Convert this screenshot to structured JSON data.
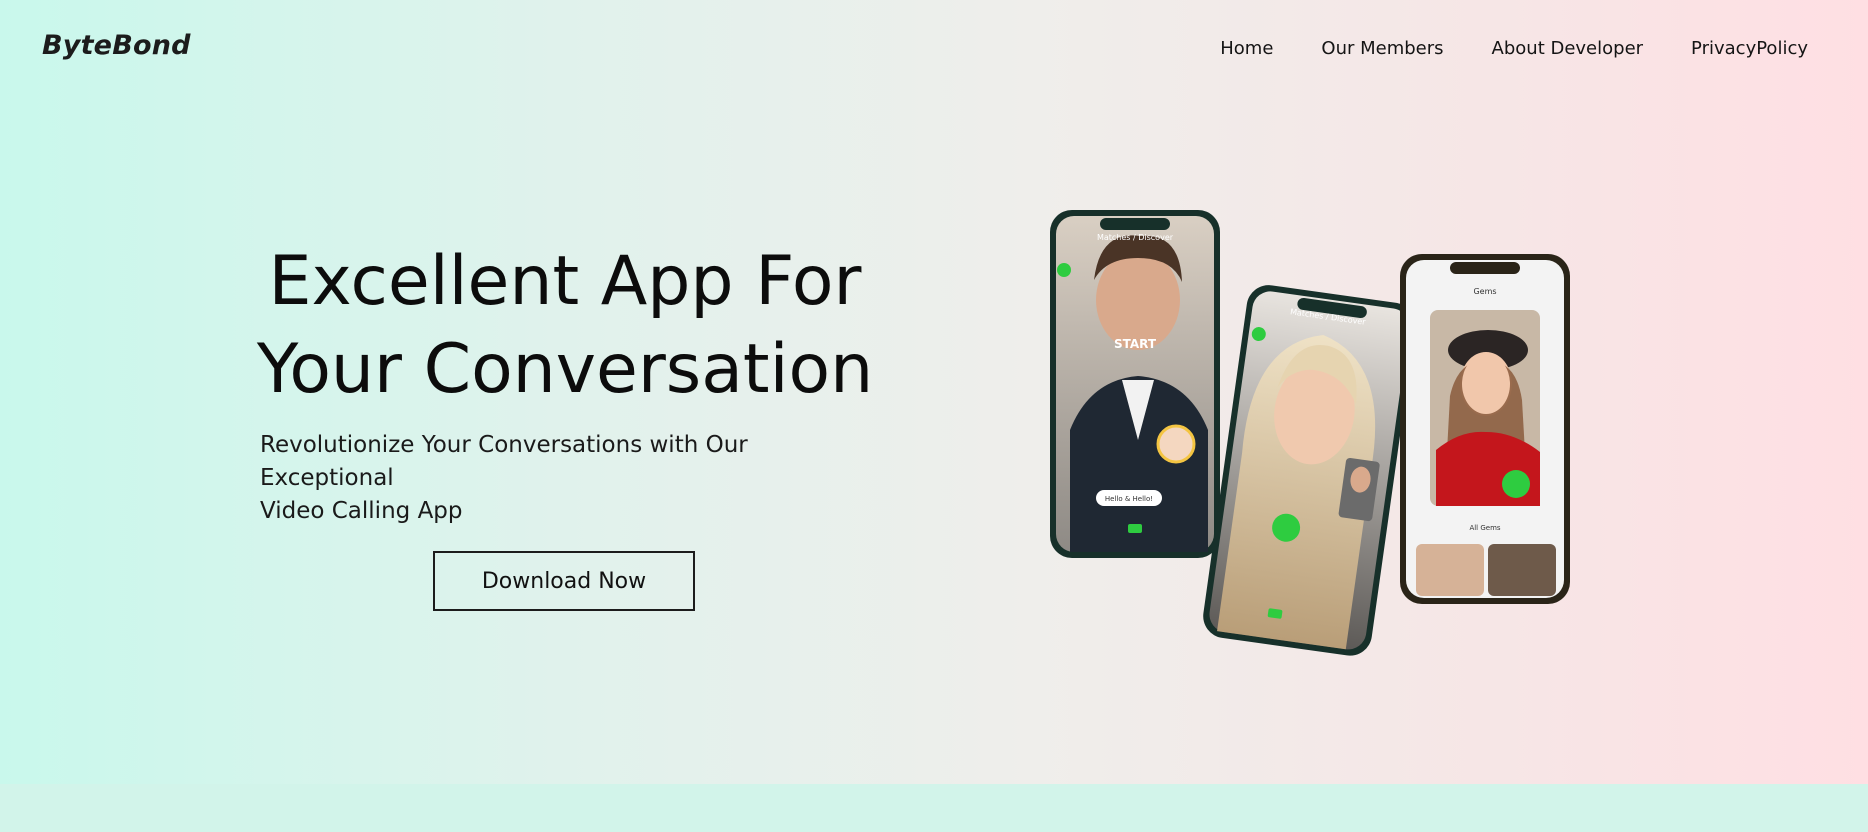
{
  "brand": {
    "logo": "ByteBond"
  },
  "nav": {
    "items": [
      "Home",
      "Our Members",
      "About Developer",
      "PrivacyPolicy"
    ]
  },
  "hero": {
    "headline_line1": "Excellent App For",
    "headline_line2": "Your Conversation",
    "subtitle_line1": "Revolutionize Your Conversations with Our Exceptional",
    "subtitle_line2": "Video Calling App",
    "cta_label": "Download Now"
  },
  "phones": {
    "left_tabs": "Matches / Discover",
    "left_start": "START",
    "left_chip": "Hello & Hello!",
    "middle_header": "Matches / Discover",
    "right_header": "Gems",
    "right_caption": "All Gems"
  },
  "colors": {
    "gradient_left": "#c9f8ec",
    "gradient_right": "#ffdfe3",
    "accent_green": "#2ecc40"
  }
}
